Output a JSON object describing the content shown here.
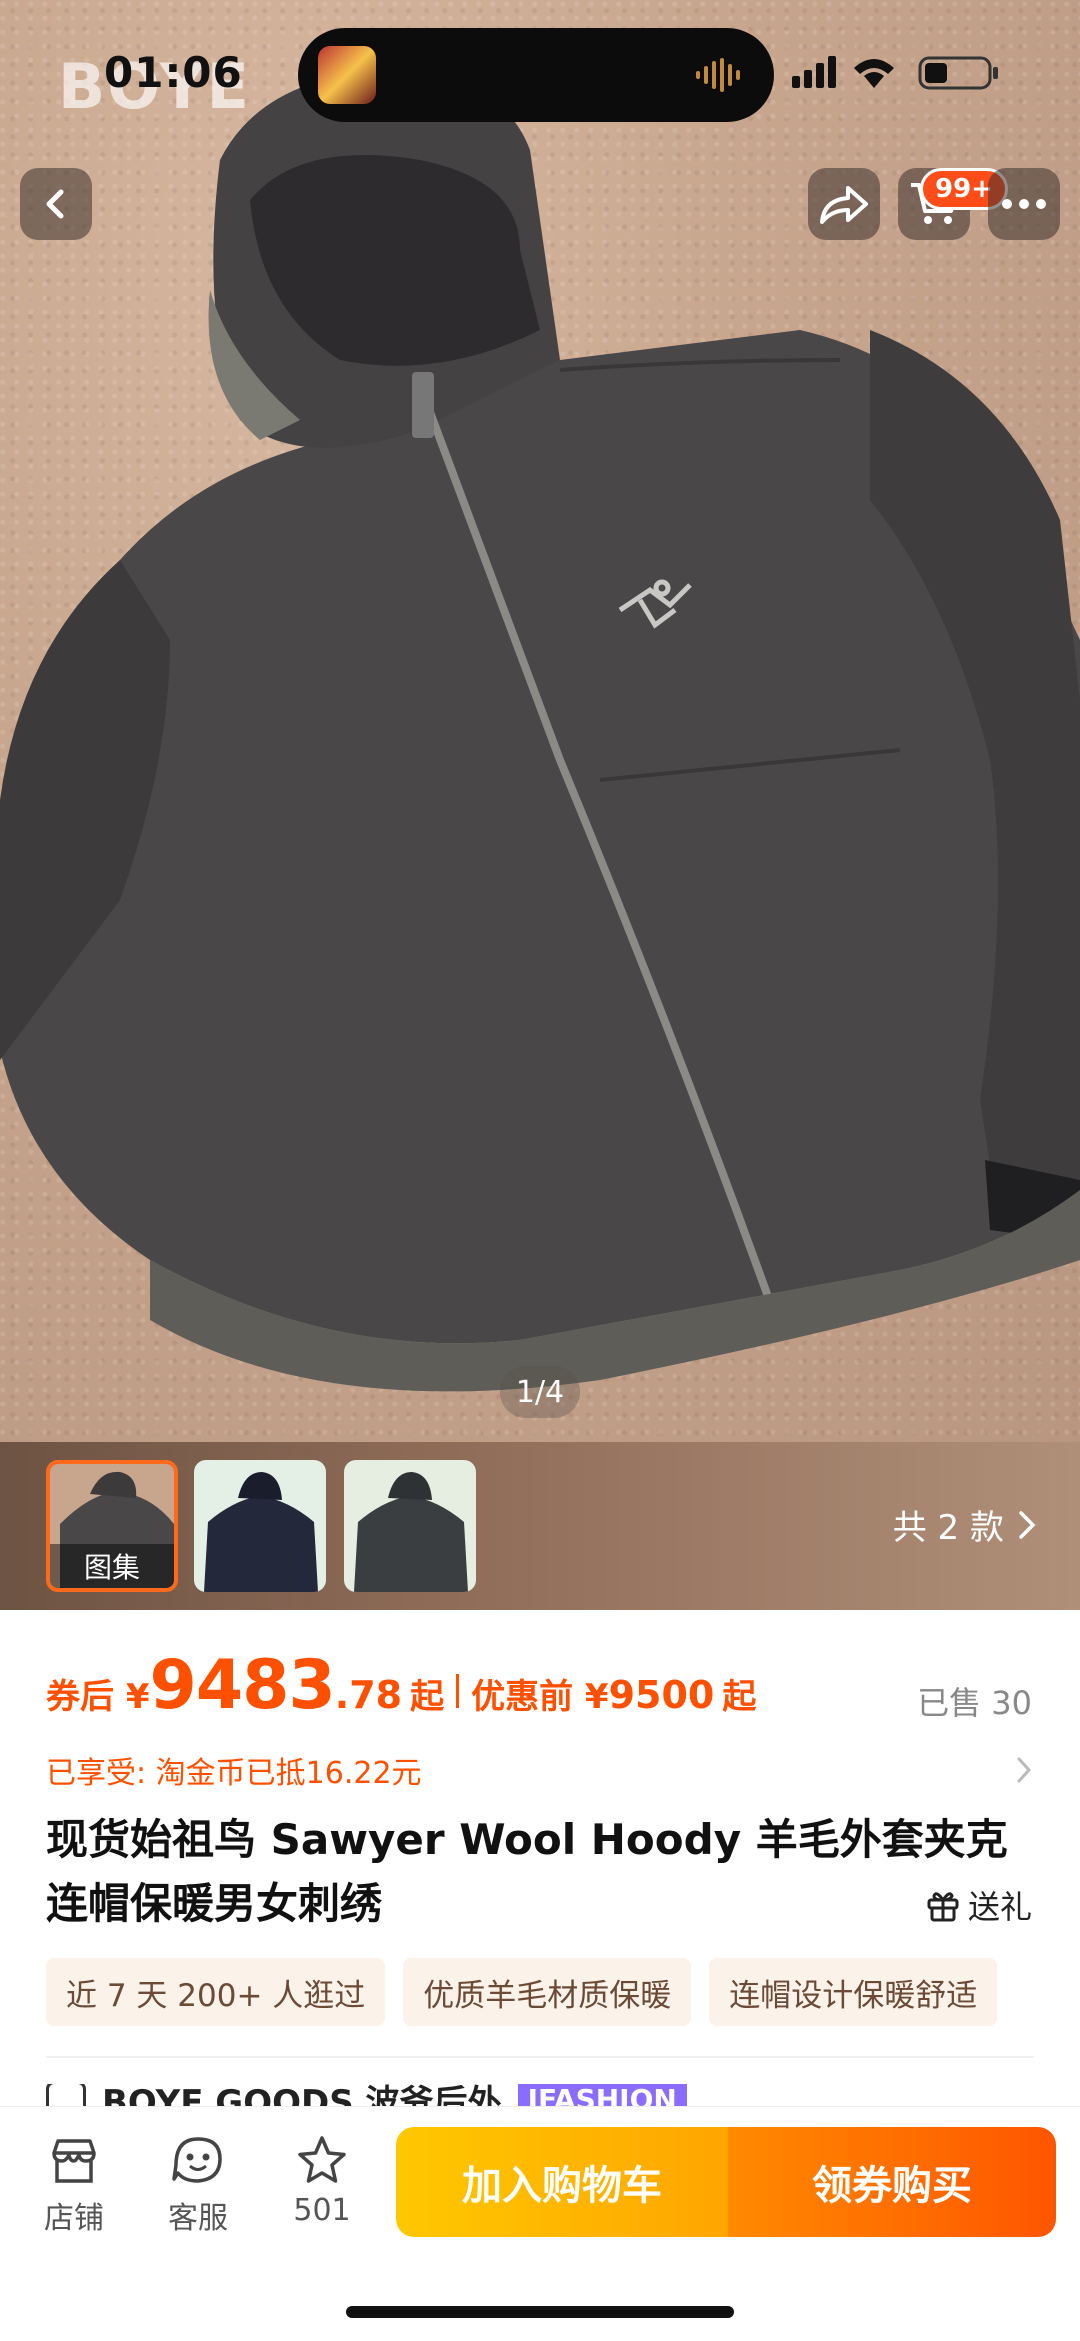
{
  "status_bar": {
    "time": "01:06",
    "brand_watermark": "BOYE"
  },
  "nav": {
    "back_icon": "chevron-left-icon",
    "share_icon": "share-icon",
    "cart_icon": "cart-icon",
    "cart_badge": "99+",
    "more_icon": "more-dots-icon"
  },
  "gallery": {
    "pager": "1/4",
    "thumbnails": [
      {
        "label": "图集"
      },
      {
        "label": ""
      },
      {
        "label": ""
      }
    ],
    "variant_count": "共 2 款"
  },
  "price": {
    "prefix": "券后 ¥",
    "integer": "9483",
    "decimal": ".78",
    "suffix": "起",
    "original_label": "优惠前 ¥",
    "original_value": "9500",
    "original_suffix": "起",
    "sold": "已售 30"
  },
  "benefit": {
    "text": "已享受: 淘金币已抵16.22元"
  },
  "product": {
    "title": "现货始祖鸟 Sawyer Wool Hoody 羊毛外套夹克连帽保暖男女刺绣",
    "gift_label": "送礼"
  },
  "tags": [
    "近 7 天 200+ 人逛过",
    "优质羊毛材质保暖",
    "连帽设计保暖舒适"
  ],
  "shop": {
    "name": "BOYE GOODS 波爷后外",
    "badge": "IFASHION"
  },
  "bottom_bar": {
    "store": "店铺",
    "service": "客服",
    "favorites": "501",
    "add_to_cart": "加入购物车",
    "buy_with_coupon": "领券购买"
  },
  "colors": {
    "accent": "#ff5000",
    "cart_button": "#ffb300",
    "buy_button": "#ff6a00",
    "jacket": "#4a4749",
    "carpet": "#c9a78f"
  }
}
